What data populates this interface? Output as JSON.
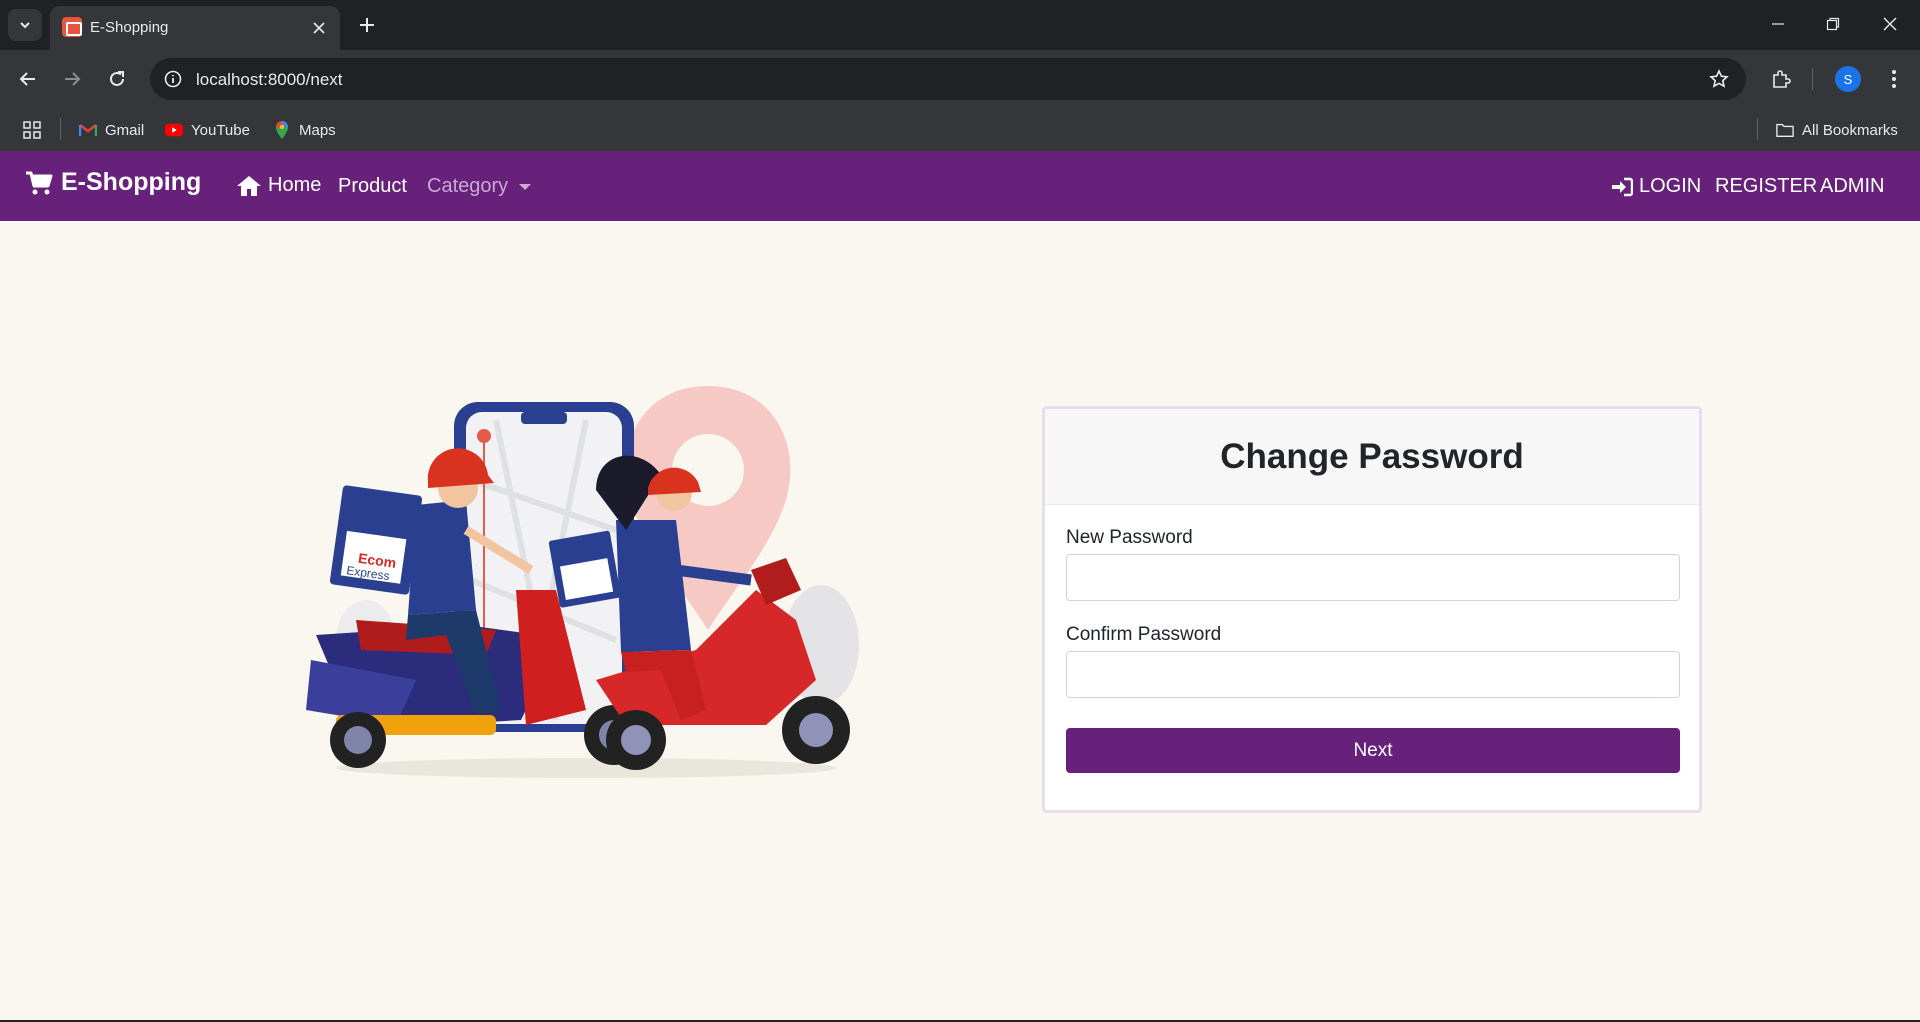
{
  "browser": {
    "tab_title": "E-Shopping",
    "url": "localhost:8000/next",
    "profile_initial": "S",
    "bookmarks": [
      {
        "label": "Gmail",
        "icon": "gmail-icon"
      },
      {
        "label": "YouTube",
        "icon": "youtube-icon"
      },
      {
        "label": "Maps",
        "icon": "maps-icon"
      }
    ],
    "all_bookmarks": "All Bookmarks"
  },
  "navbar": {
    "brand": "E-Shopping",
    "home": "Home",
    "product": "Product",
    "category": "Category",
    "login": "LOGIN",
    "register": "REGISTER",
    "admin": "ADMIN",
    "color": "#68217a"
  },
  "form": {
    "title": "Change Password",
    "new_password_label": "New Password",
    "new_password_value": "",
    "confirm_password_label": "Confirm Password",
    "confirm_password_value": "",
    "submit_label": "Next"
  },
  "illustration": {
    "box_text_top": "Ecom",
    "box_text_bottom": "Express"
  }
}
